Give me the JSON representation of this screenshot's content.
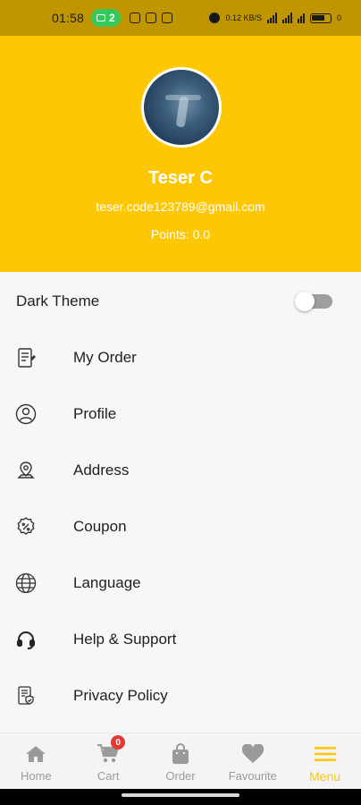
{
  "status_bar": {
    "time": "01:58",
    "notification_count": "2",
    "network_speed": "0.12 KB/S",
    "battery": "0",
    "icon_names": [
      "alarm-icon",
      "wifi-icon",
      "signal-icon",
      "battery-icon"
    ]
  },
  "profile": {
    "name": "Teser C",
    "email": "teser.code123789@gmail.com",
    "points": "Points: 0.0"
  },
  "settings": {
    "dark_theme_label": "Dark Theme",
    "dark_theme_enabled": false
  },
  "menu": {
    "items": [
      {
        "label": "My Order",
        "icon": "order-receipt-icon"
      },
      {
        "label": "Profile",
        "icon": "profile-icon"
      },
      {
        "label": "Address",
        "icon": "location-pin-icon"
      },
      {
        "label": "Coupon",
        "icon": "coupon-icon"
      },
      {
        "label": "Language",
        "icon": "globe-icon"
      },
      {
        "label": "Help & Support",
        "icon": "headset-icon"
      },
      {
        "label": "Privacy Policy",
        "icon": "privacy-icon"
      }
    ]
  },
  "bottom_nav": {
    "items": [
      {
        "label": "Home",
        "icon": "home-icon"
      },
      {
        "label": "Cart",
        "icon": "cart-icon",
        "badge": "0"
      },
      {
        "label": "Order",
        "icon": "bag-icon"
      },
      {
        "label": "Favourite",
        "icon": "heart-icon"
      },
      {
        "label": "Menu",
        "icon": "menu-icon",
        "active": true
      }
    ]
  },
  "colors": {
    "brand_yellow": "#fdc803",
    "status_bar": "#bf9500",
    "inactive_nav": "#9a9a9a",
    "badge_red": "#e53935"
  }
}
